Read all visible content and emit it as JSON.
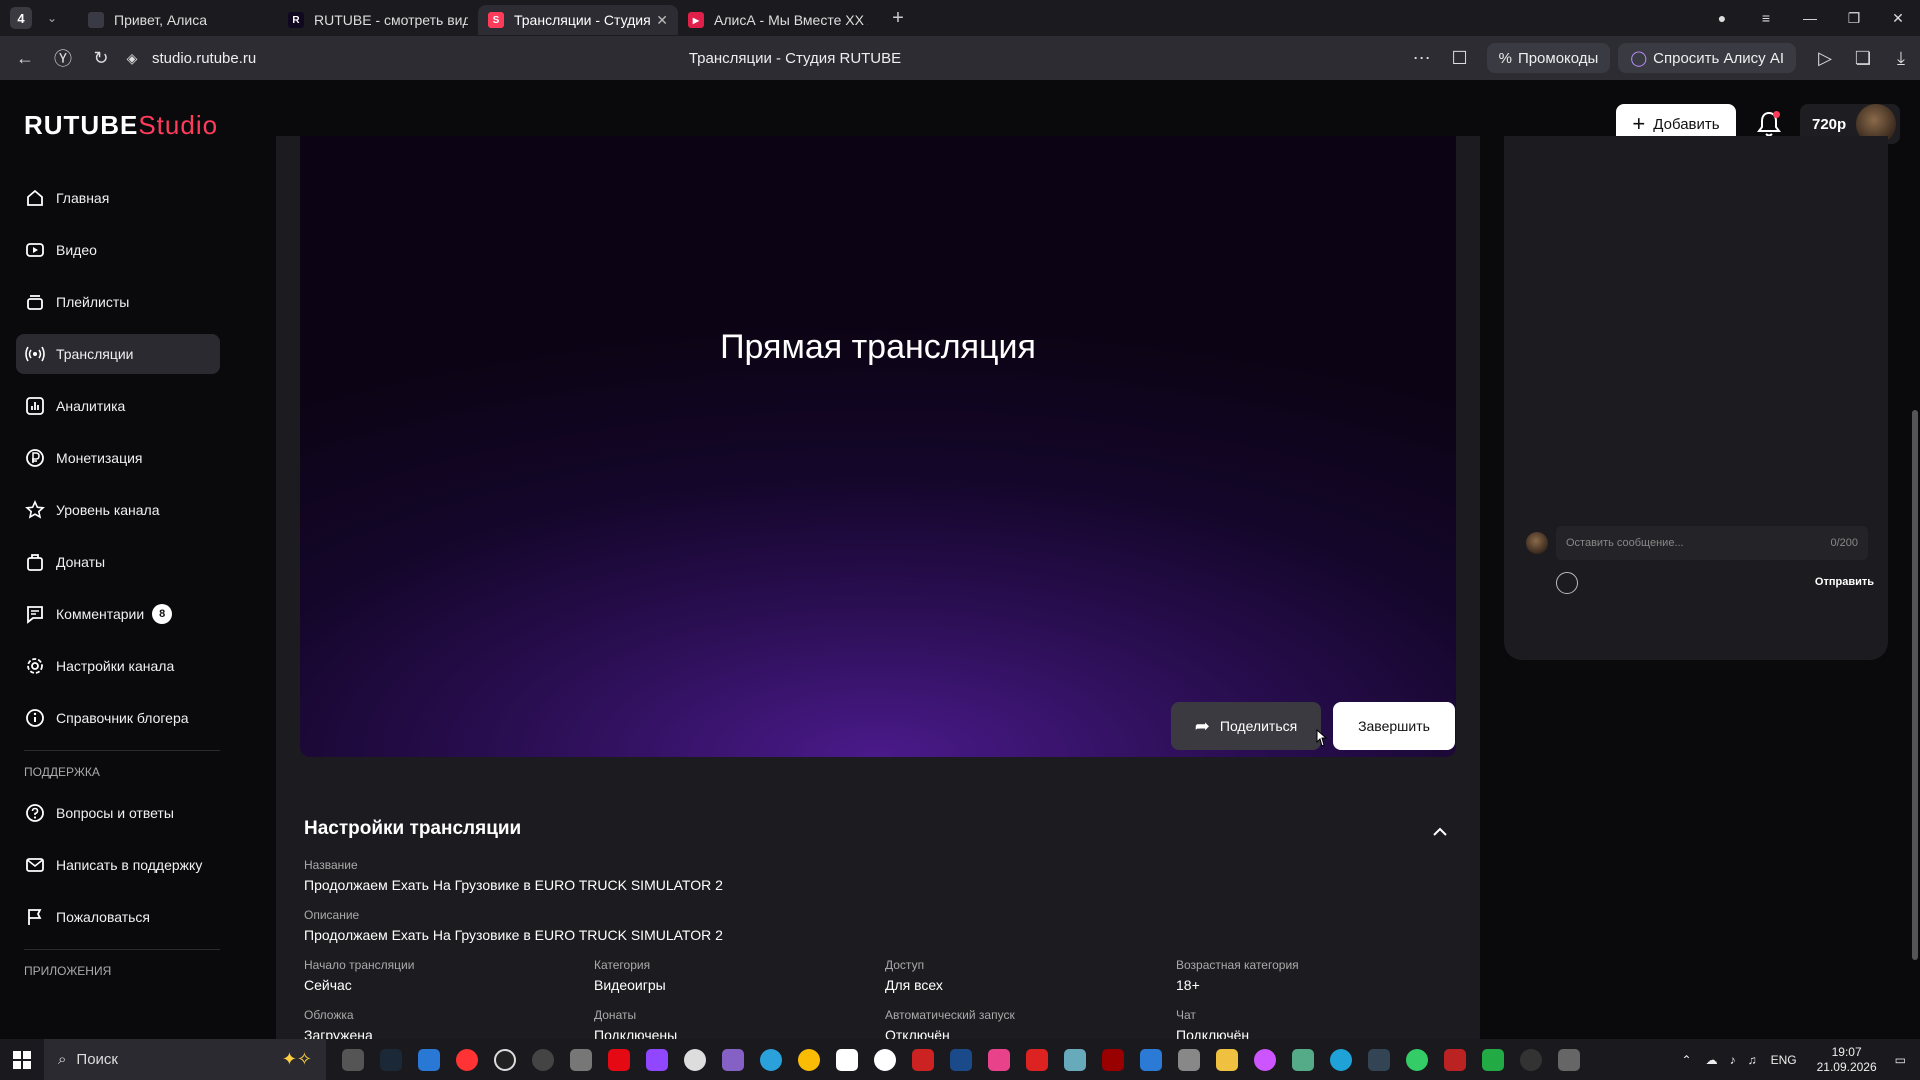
{
  "browser": {
    "tab_count": "4",
    "tabs": [
      {
        "label": "Привет, Алиса",
        "fav_color": "#3a3a44",
        "fav_text": ""
      },
      {
        "label": "RUTUBE - смотреть виде",
        "fav_color": "#100820",
        "fav_text": "R"
      },
      {
        "label": "Трансляции - Студия R",
        "fav_color": "#ff3b5c",
        "fav_text": "S",
        "active": true
      },
      {
        "label": "АлисА - Мы Вместе XX Ле",
        "fav_color": "#e0204a",
        "fav_text": "▶"
      }
    ],
    "url": "studio.rutube.ru",
    "page_title": "Трансляции - Студия RUTUBE",
    "promo_label": "Промокоды",
    "alice_label": "Спросить Алису AI"
  },
  "header": {
    "logo_main": "RUTUBE",
    "logo_sub": "Studio",
    "add_label": "Добавить",
    "quality": "720p"
  },
  "sidebar": {
    "items": [
      {
        "label": "Главная",
        "icon": "home-icon"
      },
      {
        "label": "Видео",
        "icon": "video-icon"
      },
      {
        "label": "Плейлисты",
        "icon": "playlist-icon"
      },
      {
        "label": "Трансляции",
        "icon": "broadcast-icon",
        "active": true
      },
      {
        "label": "Аналитика",
        "icon": "analytics-icon"
      },
      {
        "label": "Монетизация",
        "icon": "monetization-icon"
      },
      {
        "label": "Уровень канала",
        "icon": "star-icon"
      },
      {
        "label": "Донаты",
        "icon": "donate-icon"
      },
      {
        "label": "Комментарии",
        "icon": "comments-icon",
        "badge": "8"
      },
      {
        "label": "Настройки канала",
        "icon": "gear-icon"
      },
      {
        "label": "Справочник блогера",
        "icon": "info-icon"
      }
    ],
    "support_title": "ПОДДЕРЖКА",
    "support_items": [
      {
        "label": "Вопросы и ответы",
        "icon": "question-icon"
      },
      {
        "label": "Написать в поддержку",
        "icon": "mail-icon"
      },
      {
        "label": "Пожаловаться",
        "icon": "flag-icon"
      }
    ],
    "apps_title": "ПРИЛОЖЕНИЯ"
  },
  "player": {
    "title": "Прямая трансляция",
    "share_label": "Поделиться",
    "finish_label": "Завершить"
  },
  "chat": {
    "placeholder": "Оставить сообщение...",
    "counter": "0/200",
    "send_label": "Отправить"
  },
  "settings": {
    "title": "Настройки трансляции",
    "name_label": "Название",
    "name_value": "Продолжаем Ехать На Грузовике в EURO TRUCK SIMULATOR 2",
    "desc_label": "Описание",
    "desc_value": "Продолжаем Ехать На Грузовике в EURO TRUCK SIMULATOR 2",
    "fields": [
      {
        "label": "Начало трансляции",
        "value": "Сейчас"
      },
      {
        "label": "Категория",
        "value": "Видеоигры"
      },
      {
        "label": "Доступ",
        "value": "Для всех"
      },
      {
        "label": "Возрастная категория",
        "value": "18+"
      },
      {
        "label": "Обложка",
        "value": "Загружена"
      },
      {
        "label": "Донаты",
        "value": "Подключены"
      },
      {
        "label": "Автоматический запуск",
        "value": "Отключён"
      },
      {
        "label": "Чат",
        "value": "Подключён"
      }
    ]
  },
  "taskbar": {
    "search_label": "Поиск",
    "lang": "ENG",
    "time": "19:07",
    "date": "21.09.2026"
  }
}
